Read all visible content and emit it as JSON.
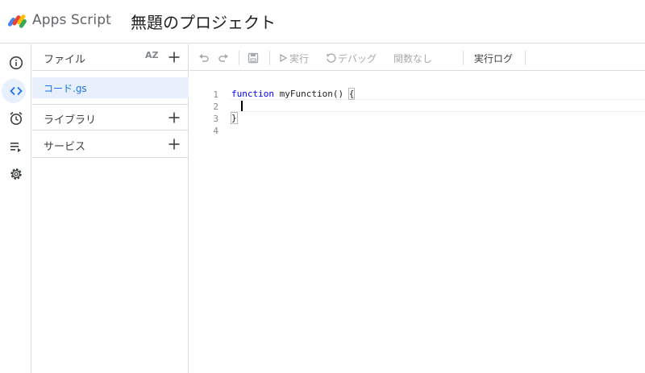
{
  "header": {
    "app_name": "Apps Script",
    "project_title": "無題のプロジェクト"
  },
  "rail": {
    "items": [
      {
        "icon": "info-icon",
        "active": false
      },
      {
        "icon": "code-icon",
        "active": true
      },
      {
        "icon": "alarm-clock-icon",
        "active": false
      },
      {
        "icon": "executions-icon",
        "active": false
      },
      {
        "icon": "gear-icon",
        "active": false
      }
    ]
  },
  "files_panel": {
    "files_label": "ファイル",
    "sort_label": "AZ",
    "files": [
      {
        "name": "コード.gs",
        "selected": true
      }
    ],
    "libraries_label": "ライブラリ",
    "services_label": "サービス"
  },
  "toolbar": {
    "run_label": "実行",
    "debug_label": "デバッグ",
    "function_select_label": "関数なし",
    "execution_log_label": "実行ログ"
  },
  "editor": {
    "line_numbers": [
      "1",
      "2",
      "3",
      "4"
    ],
    "code": {
      "keyword": "function",
      "signature": " myFunction() ",
      "open_brace": "{",
      "close_brace": "}"
    }
  },
  "colors": {
    "accent": "#1a73e8",
    "selected_bg": "#e8f0fe",
    "keyword": "#0000ff",
    "divider": "#dadce0"
  }
}
